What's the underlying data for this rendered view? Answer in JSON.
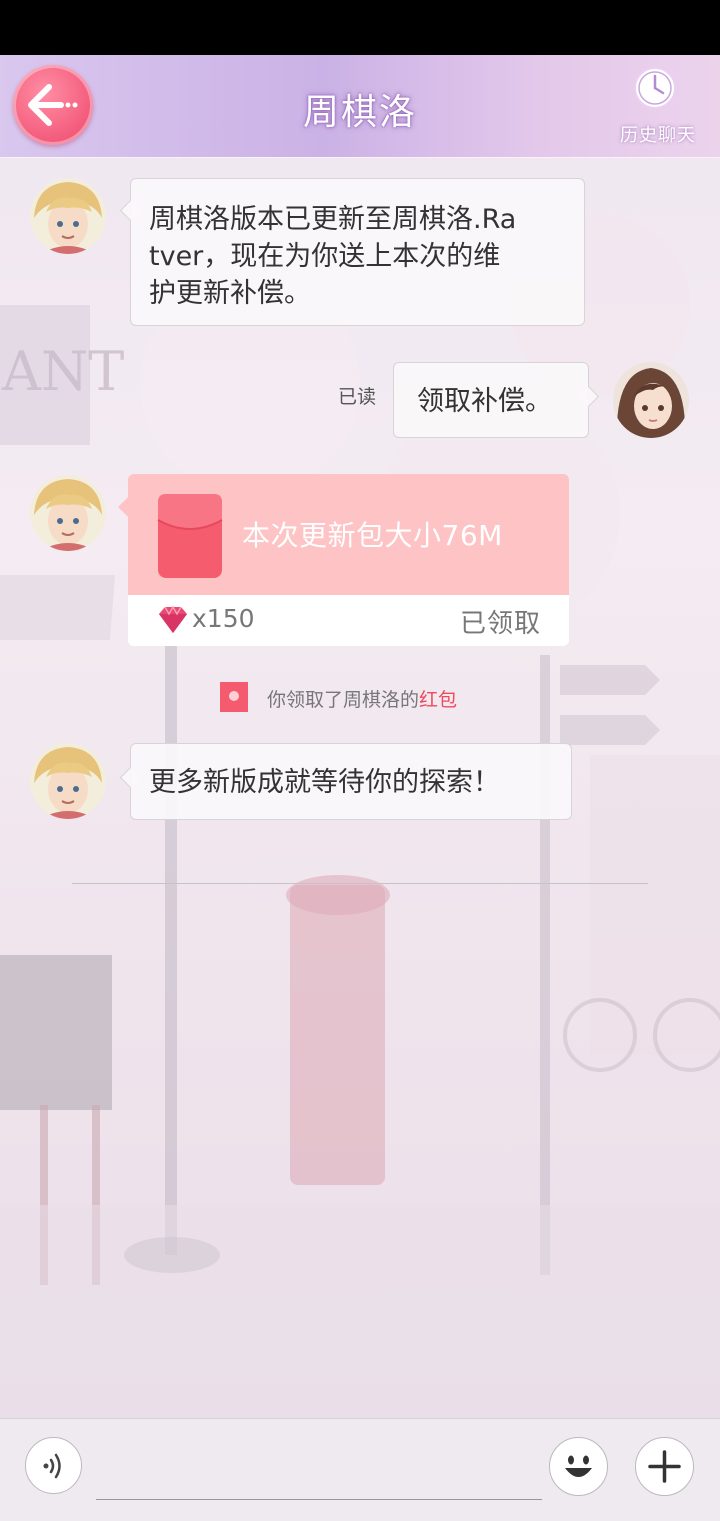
{
  "header": {
    "title": "周棋洛",
    "history_label": "历史聊天"
  },
  "messages": [
    {
      "sender": "contact",
      "text_lines": [
        "周棋洛版本已更新至周棋洛.Ra",
        "tver，现在为你送上本次的维",
        "护更新补偿。"
      ]
    },
    {
      "sender": "self",
      "text": "领取补偿。",
      "read_receipt": "已读"
    },
    {
      "sender": "contact",
      "type": "red_packet",
      "title": "本次更新包大小76M",
      "reward_amount": "x150",
      "status": "已领取"
    },
    {
      "sender": "contact",
      "text": "更多新版成就等待你的探索！"
    }
  ],
  "notice": {
    "prefix": "你领取了周棋洛的",
    "highlight": "红包"
  },
  "input": {
    "placeholder": ""
  },
  "icons": {
    "back": "back-arrow-icon",
    "history": "clock-icon",
    "envelope": "red-packet-icon",
    "gem": "diamond-icon",
    "voice": "voice-icon",
    "emoji": "smiley-icon",
    "plus": "plus-icon"
  },
  "colors": {
    "accent_pink": "#f35a7b",
    "red_packet_bg": "#fdc3c5",
    "highlight_red": "#ee4a5e",
    "header_purple": "#cbb2e6"
  }
}
